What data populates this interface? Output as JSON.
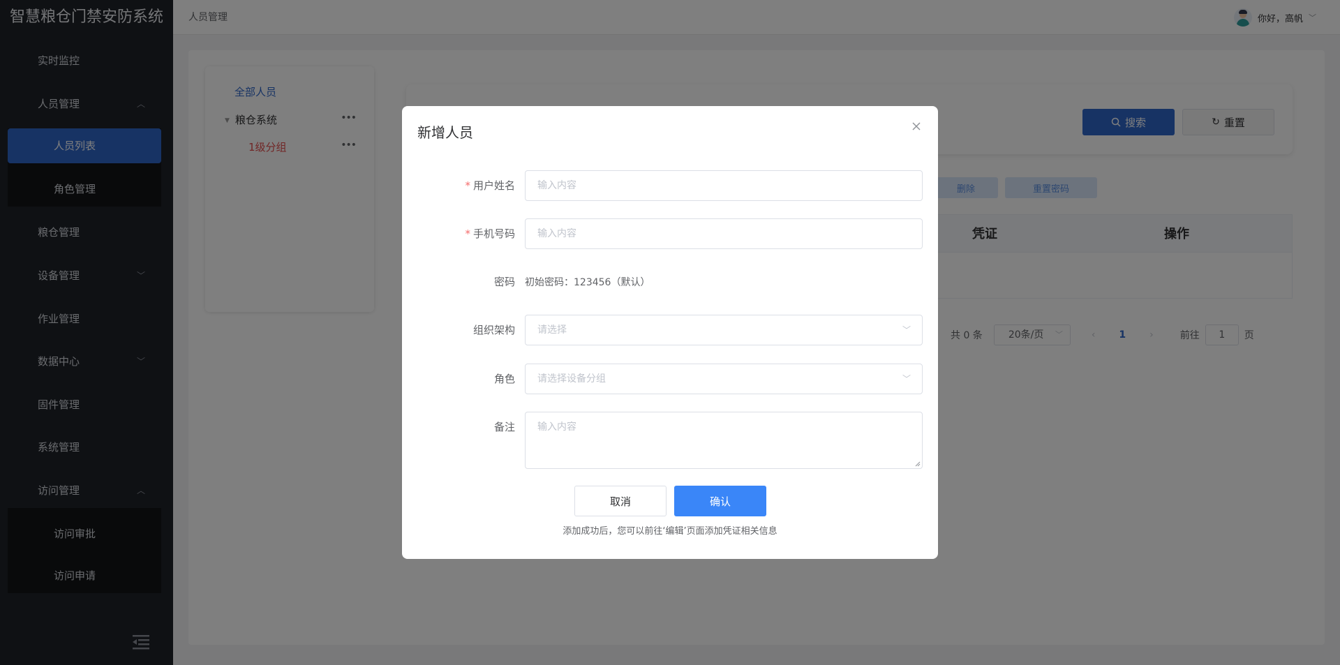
{
  "app": {
    "title": "智慧粮仓门禁安防系统"
  },
  "sidebar": {
    "items": [
      {
        "label": "实时监控"
      },
      {
        "label": "人员管理",
        "chevron": "up"
      },
      {
        "label": "人员列表",
        "active": true
      },
      {
        "label": "角色管理"
      },
      {
        "label": "粮仓管理"
      },
      {
        "label": "设备管理",
        "chevron": "down"
      },
      {
        "label": "作业管理"
      },
      {
        "label": "数据中心",
        "chevron": "down"
      },
      {
        "label": "固件管理"
      },
      {
        "label": "系统管理"
      },
      {
        "label": "访问管理",
        "chevron": "up"
      },
      {
        "label": "访问审批"
      },
      {
        "label": "访问申请"
      }
    ]
  },
  "header": {
    "breadcrumb": "人员管理",
    "greeting": "你好，高帆"
  },
  "tree": {
    "all": "全部人员",
    "root": "粮仓系统",
    "child": "1级分组",
    "more": "•••"
  },
  "toolbar": {
    "search": "搜索",
    "reset": "重置",
    "delete": "删除",
    "reset_password": "重置密码"
  },
  "table": {
    "columns": [
      "凭证",
      "操作"
    ]
  },
  "pagination": {
    "total": "共 0 条",
    "page_size": "20条/页",
    "current_page": "1",
    "goto_label": "前往",
    "goto_value": "1",
    "page_suffix": "页"
  },
  "modal": {
    "title": "新增人员",
    "fields": {
      "username": {
        "label": "用户姓名",
        "placeholder": "输入内容",
        "required": true
      },
      "phone": {
        "label": "手机号码",
        "placeholder": "输入内容",
        "required": true
      },
      "password": {
        "label": "密码",
        "value": "初始密码：123456（默认）"
      },
      "org": {
        "label": "组织架构",
        "placeholder": "请选择"
      },
      "role": {
        "label": "角色",
        "placeholder": "请选择设备分组"
      },
      "remark": {
        "label": "备注",
        "placeholder": "输入内容"
      }
    },
    "cancel": "取消",
    "confirm": "确认",
    "note": "添加成功后，您可以前往‘编辑’页面添加凭证相关信息"
  },
  "colors": {
    "sidebar_bg": "#1f2229",
    "accent": "#2f66c9",
    "confirm": "#3a86f8",
    "required": "#f56c6c"
  }
}
